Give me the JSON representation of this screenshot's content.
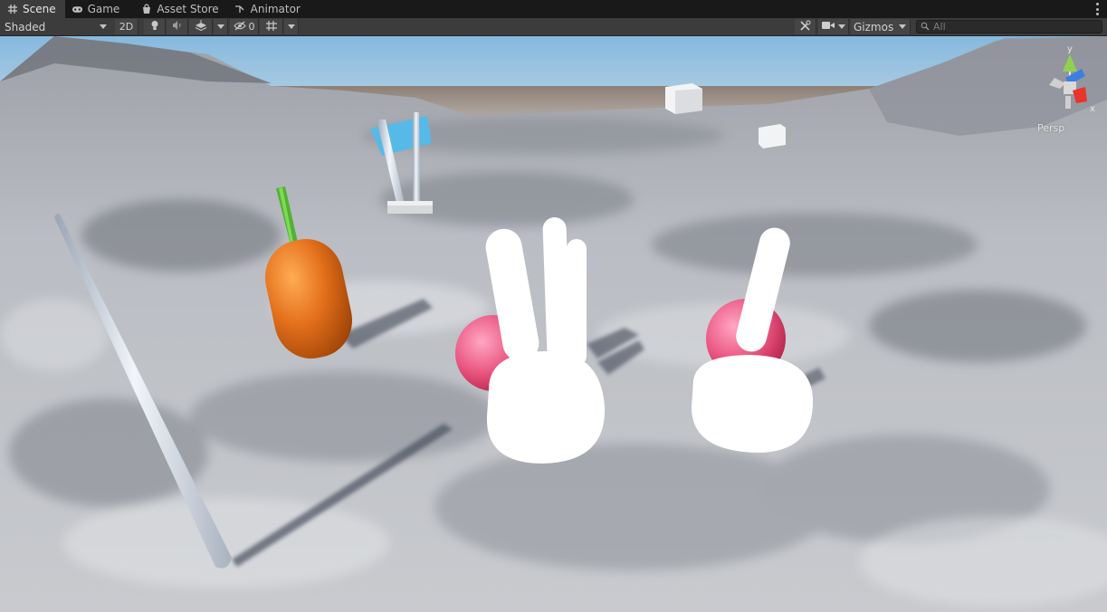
{
  "tabs": [
    {
      "label": "Scene",
      "icon": "scene-grid-icon",
      "active": true
    },
    {
      "label": "Game",
      "icon": "gamepad-icon",
      "active": false
    },
    {
      "label": "Asset Store",
      "icon": "shopping-bag-icon",
      "active": false
    },
    {
      "label": "Animator",
      "icon": "animator-icon",
      "active": false
    }
  ],
  "toolbar": {
    "draw_mode": "Shaded",
    "mode_2d": "2D",
    "hidden_count": "0",
    "gizmos": "Gizmos",
    "search_placeholder": "All"
  },
  "gizmo": {
    "axis_y": "y",
    "axis_x": "x",
    "projection": "Persp"
  },
  "colors": {
    "tab_bar": "#191919",
    "toolbar": "#3c3c3c",
    "active_tab": "#3c3c3c",
    "gizmo_y": "#8fd14f",
    "gizmo_x": "#e8342a",
    "gizmo_z": "#3d7fe0"
  }
}
